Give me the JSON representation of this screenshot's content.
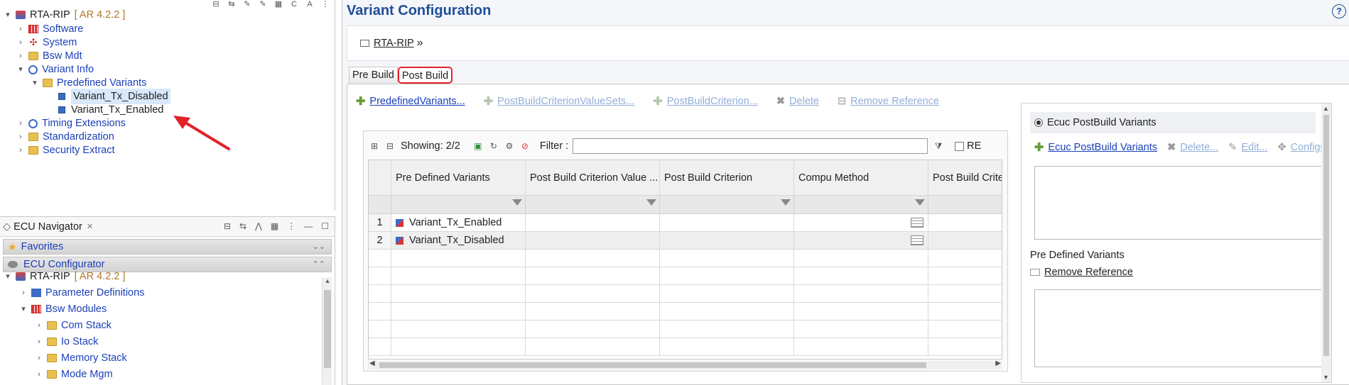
{
  "project_tree": {
    "root": {
      "label": "RTA-RIP",
      "version": "[ AR 4.2.2 ]"
    },
    "items": [
      {
        "label": "Software"
      },
      {
        "label": "System"
      },
      {
        "label": "Bsw Mdt"
      },
      {
        "label": "Variant Info"
      },
      {
        "label": "Predefined Variants"
      },
      {
        "label": "Variant_Tx_Disabled"
      },
      {
        "label": "Variant_Tx_Enabled"
      },
      {
        "label": "Timing Extensions"
      },
      {
        "label": "Standardization"
      },
      {
        "label": "Security Extract"
      }
    ]
  },
  "ecu_navigator": {
    "title": "ECU Navigator",
    "favorites_label": "Favorites",
    "configurator_label": "ECU Configurator",
    "root": {
      "label": "RTA-RIP",
      "version": "[ AR 4.2.2 ]"
    },
    "items": [
      {
        "label": "Parameter Definitions"
      },
      {
        "label": "Bsw Modules"
      },
      {
        "label": "Com Stack"
      },
      {
        "label": "Io Stack"
      },
      {
        "label": "Memory Stack"
      },
      {
        "label": "Mode Mgm"
      }
    ]
  },
  "editor": {
    "title": "Variant Configuration",
    "help": "?",
    "breadcrumb": {
      "link": "RTA-RIP",
      "sep": "»"
    },
    "tabs": [
      {
        "label": "Pre Build"
      },
      {
        "label": "Post Build"
      }
    ],
    "actions": [
      {
        "label": "PredefinedVariants..."
      },
      {
        "label": "PostBuildCriterionValueSets..."
      },
      {
        "label": "PostBuildCriterion..."
      },
      {
        "label": "Delete"
      },
      {
        "label": "Remove Reference"
      }
    ],
    "grid_toolbar": {
      "showing": "Showing: 2/2",
      "filter_label": "Filter :",
      "re_label": "RE"
    },
    "table": {
      "columns": [
        "Pre Defined Variants",
        "Post Build Criterion Value ...",
        "Post Build Criterion",
        "Compu Method",
        "Post Build Criteri"
      ],
      "rows": [
        {
          "num": "1",
          "variant": "Variant_Tx_Enabled"
        },
        {
          "num": "2",
          "variant": "Variant_Tx_Disabled"
        }
      ]
    },
    "side_panel": {
      "header": "Ecuc PostBuild Variants",
      "actions": [
        {
          "label": "Ecuc PostBuild Variants"
        },
        {
          "label": "Delete..."
        },
        {
          "label": "Edit..."
        },
        {
          "label": "Configu"
        }
      ],
      "section_label": "Pre Defined Variants",
      "remove_reference": "Remove Reference"
    }
  },
  "colors": {
    "accent": "#1f4e99",
    "link": "#1a3fb8",
    "highlight": "#e0232a",
    "version": "#b0762c"
  }
}
